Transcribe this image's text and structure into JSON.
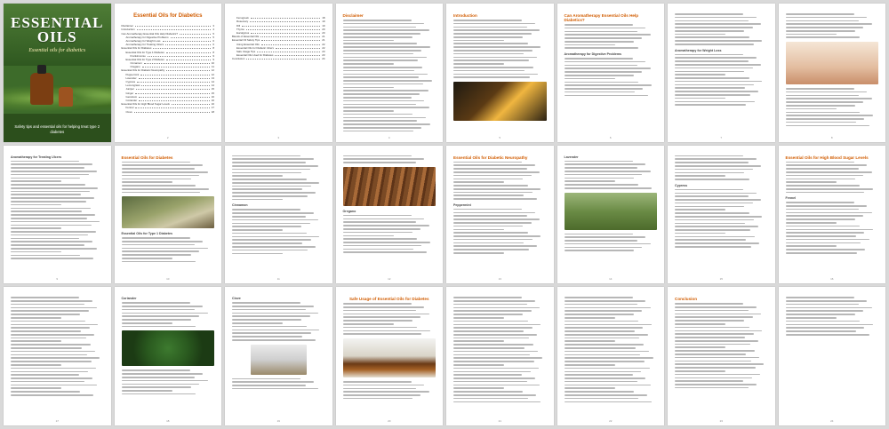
{
  "cover": {
    "title": "ESSENTIAL OILS",
    "subtitle": "Essential oils for diabetics",
    "tagline": "Safety tips and essential oils for helping treat type 2 diabetes"
  },
  "toc": {
    "title": "Essential Oils for Diabetics",
    "entries": [
      {
        "label": "Disclaimer",
        "page": "3",
        "indent": 0
      },
      {
        "label": "Introduction",
        "page": "4",
        "indent": 0
      },
      {
        "label": "Can Aromatherapy Essential Oils Help Diabetics?",
        "page": "5",
        "indent": 0
      },
      {
        "label": "Aromatherapy for Digestive Problems",
        "page": "5",
        "indent": 1
      },
      {
        "label": "Aromatherapy for Weight Loss",
        "page": "6",
        "indent": 1
      },
      {
        "label": "Aromatherapy for Treating Ulcers",
        "page": "6",
        "indent": 1
      },
      {
        "label": "Essential Oils for Diabetes",
        "page": "8",
        "indent": 0
      },
      {
        "label": "Essential Oils for Type 1 Diabetes",
        "page": "8",
        "indent": 1
      },
      {
        "label": "Frankincense",
        "page": "9",
        "indent": 2
      },
      {
        "label": "Essential Oils for Type 2 Diabetes",
        "page": "9",
        "indent": 1
      },
      {
        "label": "Cinnamon",
        "page": "10",
        "indent": 2
      },
      {
        "label": "Oregano",
        "page": "11",
        "indent": 2
      },
      {
        "label": "Essential Oils for Diabetic Neuropathy",
        "page": "12",
        "indent": 0
      },
      {
        "label": "Peppermint",
        "page": "12",
        "indent": 1
      },
      {
        "label": "Lavender",
        "page": "13",
        "indent": 1
      },
      {
        "label": "Cypress",
        "page": "14",
        "indent": 1
      },
      {
        "label": "Lemongrass",
        "page": "14",
        "indent": 1
      },
      {
        "label": "Juniper",
        "page": "15",
        "indent": 1
      },
      {
        "label": "Ginger",
        "page": "15",
        "indent": 1
      },
      {
        "label": "Geranium",
        "page": "16",
        "indent": 1
      },
      {
        "label": "Coriander",
        "page": "16",
        "indent": 1
      },
      {
        "label": "Essential Oils for High Blood Sugar Levels",
        "page": "16",
        "indent": 0
      },
      {
        "label": "Fennel",
        "page": "17",
        "indent": 1
      },
      {
        "label": "Clove",
        "page": "18",
        "indent": 1
      }
    ],
    "entries2": [
      {
        "label": "Fenugreek",
        "page": "18",
        "indent": 1
      },
      {
        "label": "Rosemary",
        "page": "19",
        "indent": 1
      },
      {
        "label": "Dill",
        "page": "19",
        "indent": 1
      },
      {
        "label": "Thyme",
        "page": "20",
        "indent": 1
      },
      {
        "label": "Eucalyptus",
        "page": "20",
        "indent": 1
      },
      {
        "label": "Blends of Essential Oils",
        "page": "21",
        "indent": 0
      },
      {
        "label": "Essential Oil Safety Tips",
        "page": "21",
        "indent": 0
      },
      {
        "label": "Using Essential Oils",
        "page": "22",
        "indent": 1
      },
      {
        "label": "Essential Oils for Diabetic Ulcers",
        "page": "22",
        "indent": 1
      },
      {
        "label": "Safe Usage Tips",
        "page": "23",
        "indent": 1
      },
      {
        "label": "Essential Oils Used for Diabetes",
        "page": "23",
        "indent": 1
      },
      {
        "label": "Conclusion",
        "page": "24",
        "indent": 0
      }
    ]
  },
  "pages": [
    {
      "num": "1"
    },
    {
      "num": "2"
    },
    {
      "num": "3",
      "heading": "Disclaimer"
    },
    {
      "num": "4",
      "heading": "Introduction"
    },
    {
      "num": "5",
      "heading": "Can Aromatherapy Essential Oils Help Diabetics?",
      "sub": "Aromatherapy for Digestive Problems"
    },
    {
      "num": "6",
      "sub": "Aromatherapy for Weight Loss"
    },
    {
      "num": "7",
      "sub": "Aromatherapy for Treating Ulcers"
    },
    {
      "num": "8",
      "sub": "Aromatherapy for Treating Ulcers"
    },
    {
      "num": "9",
      "sub": "Aromatherapy for Treating Ulcers"
    },
    {
      "num": "10",
      "heading": "Essential Oils for Diabetes",
      "sub": "Essential Oils for Type 1 Diabetes"
    },
    {
      "num": "11",
      "sub": "Cinnamon"
    },
    {
      "num": "12",
      "sub": "Oregano"
    },
    {
      "num": "13",
      "heading": "Essential Oils for Diabetic Neuropathy",
      "sub": "Peppermint"
    },
    {
      "num": "14",
      "sub": "Lavender"
    },
    {
      "num": "15",
      "sub": "Cypress"
    },
    {
      "num": "16",
      "heading": "Essential Oils for High Blood Sugar Levels",
      "sub": "Fennel"
    },
    {
      "num": "17"
    },
    {
      "num": "18",
      "sub": "Coriander"
    },
    {
      "num": "19",
      "sub": "Clove"
    },
    {
      "num": "20",
      "heading": "Safe Usage of Essential Oils for Diabetes"
    },
    {
      "num": "21"
    },
    {
      "num": "22"
    },
    {
      "num": "23",
      "heading": "Conclusion"
    },
    {
      "num": "24"
    }
  ]
}
